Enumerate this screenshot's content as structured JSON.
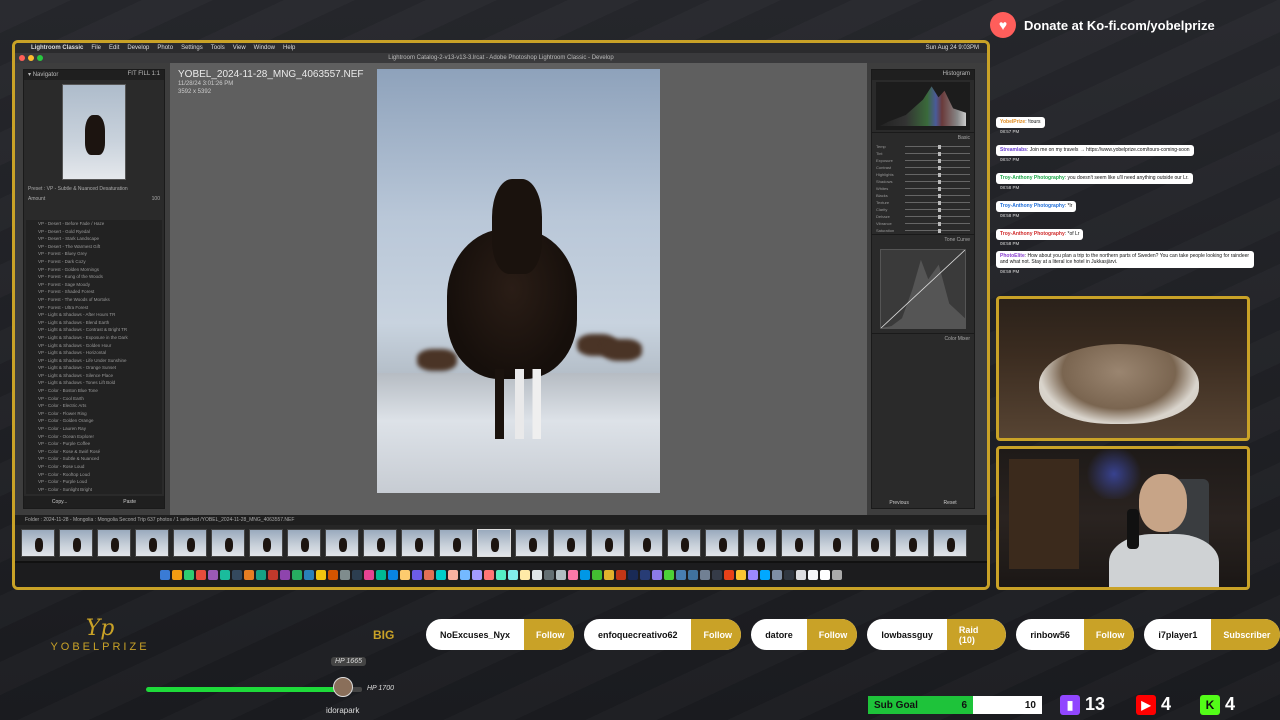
{
  "kofi": {
    "text": "Donate at Ko-fi.com/yobelprize"
  },
  "mac_menu": {
    "app": "Lightroom Classic",
    "items": [
      "File",
      "Edit",
      "Develop",
      "Photo",
      "Settings",
      "Tools",
      "View",
      "Window",
      "Help"
    ],
    "clock": "Sun Aug 24  9:03PM"
  },
  "window": {
    "title": "Lightroom Catalog-2-v13-v13-3.lrcat - Adobe Photoshop Lightroom Classic - Develop"
  },
  "navigator": {
    "label": "Navigator",
    "fit": "FIT  FILL  1:1"
  },
  "preset_hover": {
    "label": "Preset : VP - Subtle & Nuanced Desaturation",
    "amount": "Amount",
    "amount_value": "100"
  },
  "presets": [
    "VP - Desert - Before Fade / Haze",
    "VP - Desert - Gold Ryedal",
    "VP - Desert - Stark Landscape",
    "VP - Desert - The Warmest Gift",
    "VP - Forest - Bluey Grey",
    "VP - Forest - Dark Cozy",
    "VP - Forest - Golden Mornings",
    "VP - Forest - Kung of the Woods",
    "VP - Forest - Sage Moody",
    "VP - Forest - Shaded Forest",
    "VP - Forest - The Woods of Mortoks",
    "VP - Forest - Ultra Forest",
    "VP - Light & Shadows - After Hours TR",
    "VP - Light & Shadows - Blend Earth",
    "VP - Light & Shadows - Contrast & Bright TR",
    "VP - Light & Shadows - Exposure in the Dark",
    "VP - Light & Shadows - Golden Hour",
    "VP - Light & Shadows - Horizontal",
    "VP - Light & Shadows - Life Under Sunshine",
    "VP - Light & Shadows - Orange Sunset",
    "VP - Light & Shadows - Silence Place",
    "VP - Light & Shadows - Tones Lift Bold",
    "VP - Color - Boston Blue Tone",
    "VP - Color - Cool Earth",
    "VP - Color - Electric Arts",
    "VP - Color - Flower Ring",
    "VP - Color - Golden Orange",
    "VP - Color - Lauren Ray",
    "VP - Color - Ocean Explorer",
    "VP - Color - Purple Coffee",
    "VP - Color - Rose & Swirl Rosé",
    "VP - Color - Subtle & Nuanced",
    "VP - Color - Rose Loud",
    "VP - Color - Rooftop Loud",
    "VP - Color - Purple Loud",
    "VP - Color - Sunlight Bright",
    "VP - Color - Sunset Lush",
    "VP - Color - Winter Glow"
  ],
  "left_buttons": {
    "copy": "Copy...",
    "paste": "Paste"
  },
  "photo": {
    "filename": "YOBEL_2024-11-28_MNG_4063557.NEF",
    "date": "11/28/24 3:01:26 PM",
    "dimensions": "3592 x 5392"
  },
  "right_panel": {
    "histogram": "Histogram",
    "basic": "Basic",
    "tone_curve": "Tone Curve",
    "color_mixer": "Color Mixer",
    "previous": "Previous",
    "reset": "Reset",
    "sliders": [
      "Temp",
      "Tint",
      "Exposure",
      "Contrast",
      "Highlights",
      "Shadows",
      "Whites",
      "Blacks",
      "Texture",
      "Clarity",
      "Dehaze",
      "Vibrance",
      "Saturation"
    ]
  },
  "filmstrip": {
    "info": "Folder : 2024-11-28 - Mongolia : Mongolia Second Trip    637 photos / 1 selected /YOBEL_2024-11-28_MNG_4063557.NEF",
    "count": 25,
    "selected_index": 12
  },
  "chat": [
    {
      "user": "YobelPrize",
      "text": ": !tours",
      "time": "08:57 PM",
      "color": "#e08a1e"
    },
    {
      "user": "Streamlabs",
      "text": ": Join me on my travels → https://www.yobelprize.com/tours-coming-soon",
      "time": "08:57 PM",
      "color": "#6a3fd0"
    },
    {
      "user": "Troy-Anthony Photography",
      "text": ": you doesn't seem like u'll need anything outside our Lr.",
      "time": "08:58 PM",
      "color": "#1ea84a"
    },
    {
      "user": "Troy-Anthony Photography",
      "text": ": *lr",
      "time": "08:58 PM",
      "color": "#1f6ed8"
    },
    {
      "user": "Troy-Anthony Photography",
      "text": ": *of Lr",
      "time": "08:58 PM",
      "color": "#d02a2a"
    },
    {
      "user": "PhotoElite",
      "text": ": How about you plan a trip to the northern parts of Sweden? You can take people looking for raindeer and what not. Stay at a literal ice hotel in Jukkasjärvi.",
      "time": "08:59 PM",
      "color": "#8a3fd0"
    }
  ],
  "bottom": {
    "logo_mark": "Yp",
    "logo_text": "YOBELPRIZE",
    "big": "BIG",
    "events": [
      {
        "name": "NoExcuses_Nyx",
        "kind": "Follow"
      },
      {
        "name": "enfoquecreativo62",
        "kind": "Follow"
      },
      {
        "name": "datore",
        "kind": "Follow"
      },
      {
        "name": "lowbassguy",
        "kind": "Raid (10)"
      },
      {
        "name": "rinbow56",
        "kind": "Follow"
      },
      {
        "name": "i7player1",
        "kind": "Subscriber"
      }
    ],
    "hp_top": "HP 1665",
    "hp_right": "HP 1700",
    "hp_fraction": 0.98,
    "player": "idorapark",
    "sub_goal": {
      "label": "Sub Goal",
      "current": "6",
      "target": "10"
    },
    "platforms": [
      {
        "name": "twitch",
        "count": "13",
        "color": "#9146ff"
      },
      {
        "name": "youtube",
        "count": "4",
        "color": "#ff0000"
      },
      {
        "name": "kick",
        "count": "4",
        "color": "#53fc18"
      }
    ]
  }
}
